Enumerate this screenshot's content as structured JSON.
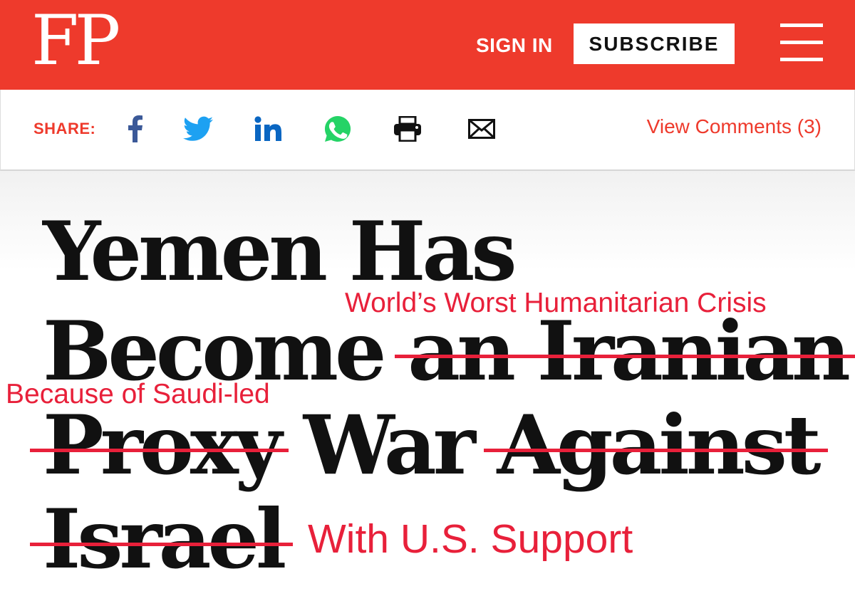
{
  "colors": {
    "brand": "#ee3a2c",
    "annotation": "#e8203a",
    "headline": "#111111"
  },
  "header": {
    "logo": "FP",
    "sign_in": "SIGN IN",
    "subscribe": "SUBSCRIBE",
    "menu_icon": "hamburger-menu-icon"
  },
  "share_bar": {
    "label": "SHARE:",
    "icons": [
      "facebook-icon",
      "twitter-icon",
      "linkedin-icon",
      "whatsapp-icon",
      "print-icon",
      "email-icon"
    ],
    "view_comments": "View Comments (3)"
  },
  "headline": {
    "line1": {
      "word1": "Yemen",
      "word2": "Has"
    },
    "line2": {
      "word1": "Become",
      "struck": "an Iranian"
    },
    "line3": {
      "struck1": "Proxy",
      "word": "War",
      "struck2": "Against"
    },
    "line4": {
      "struck": "Israel"
    }
  },
  "annotations": {
    "crisis": "World’s Worst Humanitarian Crisis",
    "saudi": "Because of Saudi-led",
    "us_support": "With U.S. Support"
  }
}
